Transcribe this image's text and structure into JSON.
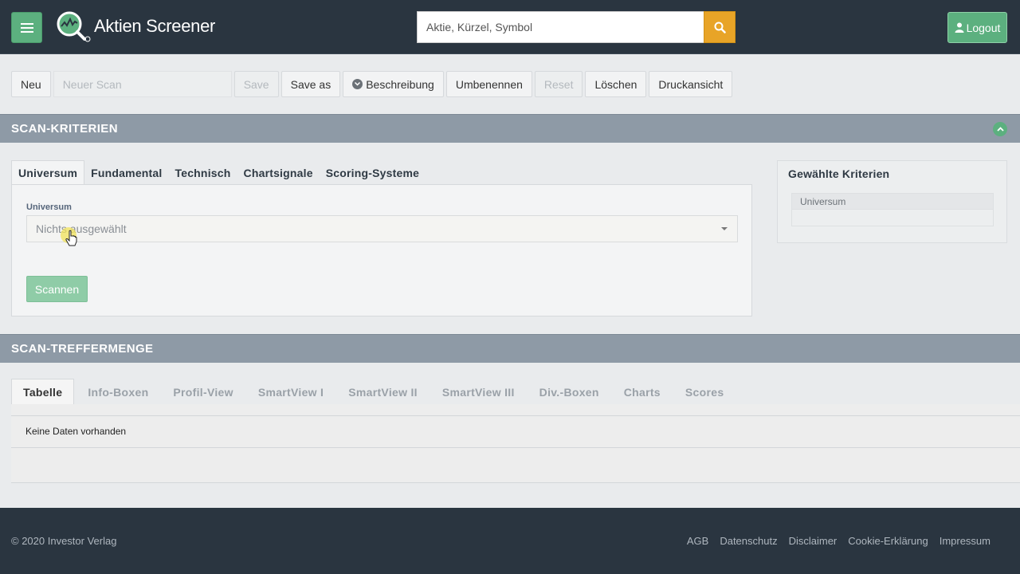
{
  "header": {
    "app_name": "Aktien Screener",
    "search_placeholder": "Aktie, Kürzel, Symbol",
    "logout_label": "Logout"
  },
  "toolbar": {
    "new_label": "Neu",
    "scan_name_placeholder": "Neuer Scan",
    "save_label": "Save",
    "save_as_label": "Save as",
    "description_label": "Beschreibung",
    "rename_label": "Umbenennen",
    "reset_label": "Reset",
    "delete_label": "Löschen",
    "print_label": "Druckansicht"
  },
  "criteria_section": {
    "title": "SCAN-KRITERIEN",
    "tabs": [
      "Universum",
      "Fundamental",
      "Technisch",
      "Chartsignale",
      "Scoring-Systeme"
    ],
    "universe_label": "Universum",
    "universe_select_value": "Nichts ausgewählt",
    "scan_button_label": "Scannen",
    "selected_title": "Gewählte Kriterien",
    "selected_items": [
      "Universum"
    ]
  },
  "results_section": {
    "title": "SCAN-TREFFERMENGE",
    "tabs": [
      "Tabelle",
      "Info-Boxen",
      "Profil-View",
      "SmartView I",
      "SmartView II",
      "SmartView III",
      "Div.-Boxen",
      "Charts",
      "Scores"
    ],
    "empty_message": "Keine Daten vorhanden"
  },
  "footer": {
    "copyright": "© 2020 Investor Verlag",
    "links": [
      "AGB",
      "Datenschutz",
      "Disclaimer",
      "Cookie-Erklärung",
      "Impressum"
    ]
  },
  "colors": {
    "header_bg": "#2a3540",
    "accent_green": "#5cb07f",
    "search_orange": "#e8a427",
    "section_bar": "#8e9aa6"
  }
}
